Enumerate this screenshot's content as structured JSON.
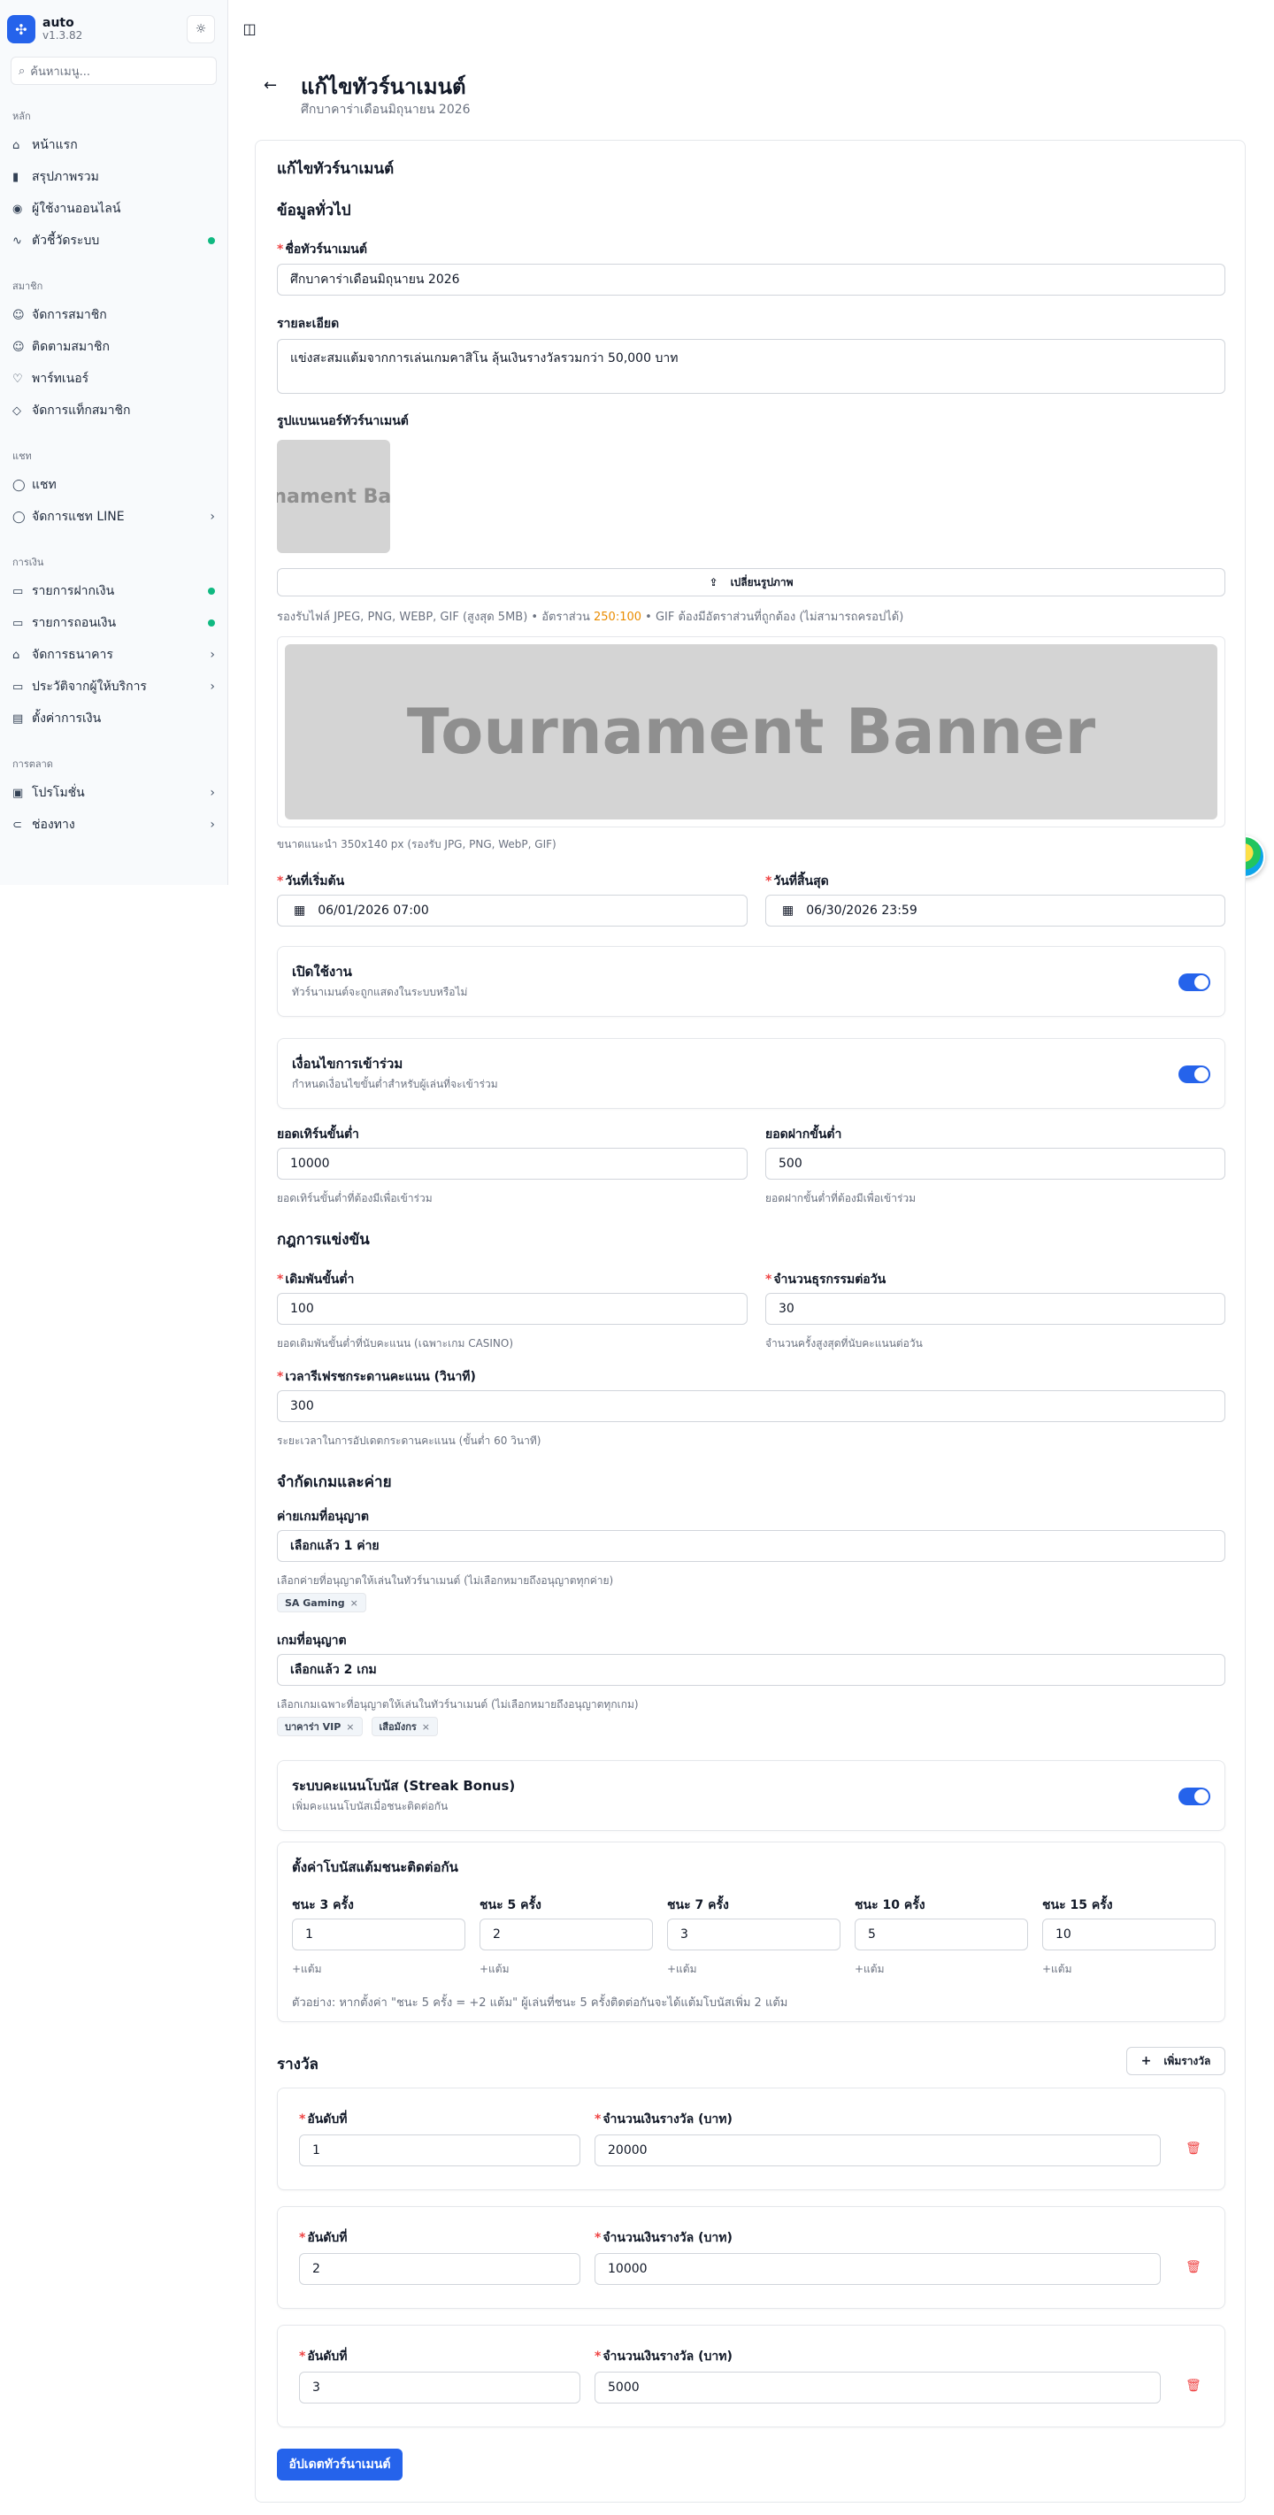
{
  "sidebar": {
    "brand": {
      "name": "auto",
      "version": "v1.3.82"
    },
    "search_placeholder": "ค้นหาเมนู...",
    "groups": {
      "main": "หลัก",
      "members": "สมาชิก",
      "chat": "แชท",
      "finance": "การเงิน",
      "marketing": "การตลาด"
    },
    "items": {
      "home": "หน้าแรก",
      "overview": "สรุปภาพรวม",
      "online_users": "ผู้ใช้งานออนไลน์",
      "system_metrics": "ตัวชี้วัดระบบ",
      "manage_members": "จัดการสมาชิก",
      "follow_members": "ติดตามสมาชิก",
      "partners": "พาร์ทเนอร์",
      "member_tags": "จัดการแท็กสมาชิก",
      "chat": "แชท",
      "line_chat": "จัดการแชท LINE",
      "deposits": "รายการฝากเงิน",
      "withdrawals": "รายการถอนเงิน",
      "banks": "จัดการธนาคาร",
      "provider_history": "ประวัติจากผู้ให้บริการ",
      "finance_settings": "ตั้งค่าการเงิน",
      "promotions": "โปรโมชั่น",
      "channels": "ช่องทาง"
    }
  },
  "header": {
    "title": "แก้ไขทัวร์นาเมนต์",
    "subtitle": "ศึกบาคาร่าเดือนมิถุนายน 2026"
  },
  "form": {
    "card_title": "แก้ไขทัวร์นาเมนต์",
    "general_title": "ข้อมูลทั่วไป",
    "name_label": "ชื่อทัวร์นาเมนต์",
    "name_value": "ศึกบาคาร่าเดือนมิถุนายน 2026",
    "desc_label": "รายละเอียด",
    "desc_value": "แข่งสะสมแต้มจากการเล่นเกมคาสิโน ลุ้นเงินรางวัลรวมกว่า 50,000 บาท",
    "banner_label": "รูปแบนเนอร์ทัวร์นาเมนต์",
    "banner_thumb_text": "Tournament Banner",
    "change_image": "เปลี่ยนรูปภาพ",
    "banner_hint_a": "รองรับไฟล์ JPEG, PNG, WEBP, GIF (สูงสุด 5MB) • อัตราส่วน ",
    "banner_hint_ratio": "250:100",
    "banner_hint_b": " • GIF ต้องมีอัตราส่วนที่ถูกต้อง (ไม่สามารถครอปได้)",
    "banner_preview_text": "Tournament Banner",
    "banner_size_hint": "ขนาดแนะนำ 350x140 px (รองรับ JPG, PNG, WebP, GIF)",
    "start_label": "วันที่เริ่มต้น",
    "start_value": "06/01/2026 07:00",
    "end_label": "วันที่สิ้นสุด",
    "end_value": "06/30/2026 23:59",
    "enabled_title": "เปิดใช้งาน",
    "enabled_desc": "ทัวร์นาเมนต์จะถูกแสดงในระบบหรือไม่",
    "conditions_title": "เงื่อนไขการเข้าร่วม",
    "conditions_desc": "กำหนดเงื่อนไขขั้นต่ำสำหรับผู้เล่นที่จะเข้าร่วม",
    "min_turnover_label": "ยอดเทิร์นขั้นต่ำ",
    "min_turnover_value": "10000",
    "min_turnover_hint": "ยอดเทิร์นขั้นต่ำที่ต้องมีเพื่อเข้าร่วม",
    "min_deposit_label": "ยอดฝากขั้นต่ำ",
    "min_deposit_value": "500",
    "min_deposit_hint": "ยอดฝากขั้นต่ำที่ต้องมีเพื่อเข้าร่วม",
    "rules_title": "กฎการแข่งขัน",
    "min_bet_label": "เดิมพันขั้นต่ำ",
    "min_bet_value": "100",
    "min_bet_hint": "ยอดเดิมพันขั้นต่ำที่นับคะแนน (เฉพาะเกม CASINO)",
    "max_tx_label": "จำนวนธุรกรรมต่อวัน",
    "max_tx_value": "30",
    "max_tx_hint": "จำนวนครั้งสูงสุดที่นับคะแนนต่อวัน",
    "refresh_label": "เวลารีเฟรชกระดานคะแนน (วินาที)",
    "refresh_value": "300",
    "refresh_hint": "ระยะเวลาในการอัปเดตกระดานคะแนน (ขั้นต่ำ 60 วินาที)",
    "games_title": "จำกัดเกมและค่าย",
    "providers_label": "ค่ายเกมที่อนุญาต",
    "providers_value": "เลือกแล้ว 1 ค่าย",
    "providers_hint": "เลือกค่ายที่อนุญาตให้เล่นในทัวร์นาเมนต์ (ไม่เลือกหมายถึงอนุญาตทุกค่าย)",
    "provider_chips": [
      "SA Gaming"
    ],
    "allowed_games_label": "เกมที่อนุญาต",
    "allowed_games_value": "เลือกแล้ว 2 เกม",
    "allowed_games_hint": "เลือกเกมเฉพาะที่อนุญาตให้เล่นในทัวร์นาเมนต์ (ไม่เลือกหมายถึงอนุญาตทุกเกม)",
    "game_chips": [
      "บาคาร่า VIP",
      "เสือมังกร"
    ],
    "chip_remove": "×",
    "streak_title": "ระบบคะแนนโบนัส (Streak Bonus)",
    "streak_desc": "เพิ่มคะแนนโบนัสเมื่อชนะติดต่อกัน",
    "streak_settings_title": "ตั้งค่าโบนัสแต้มชนะติดต่อกัน",
    "streaks": [
      {
        "label": "ชนะ 3 ครั้ง",
        "value": "1",
        "unit": "+แต้ม"
      },
      {
        "label": "ชนะ 5 ครั้ง",
        "value": "2",
        "unit": "+แต้ม"
      },
      {
        "label": "ชนะ 7 ครั้ง",
        "value": "3",
        "unit": "+แต้ม"
      },
      {
        "label": "ชนะ 10 ครั้ง",
        "value": "5",
        "unit": "+แต้ม"
      },
      {
        "label": "ชนะ 15 ครั้ง",
        "value": "10",
        "unit": "+แต้ม"
      }
    ],
    "streak_example": "ตัวอย่าง: หากตั้งค่า \"ชนะ 5 ครั้ง = +2 แต้ม\" ผู้เล่นที่ชนะ 5 ครั้งติดต่อกันจะได้แต้มโบนัสเพิ่ม 2 แต้ม",
    "prizes_title": "รางวัล",
    "add_prize": "เพิ่มรางวัล",
    "rank_label": "อันดับที่",
    "amount_label": "จำนวนเงินรางวัล (บาท)",
    "prizes": [
      {
        "rank": "1",
        "amount": "20000"
      },
      {
        "rank": "2",
        "amount": "10000"
      },
      {
        "rank": "3",
        "amount": "5000"
      }
    ],
    "submit": "อัปเดตทัวร์นาเมนต์"
  },
  "colors": {
    "accent": "#2563eb",
    "danger": "#ef4444",
    "success": "#10b981",
    "ratio": "#ea8c00"
  }
}
